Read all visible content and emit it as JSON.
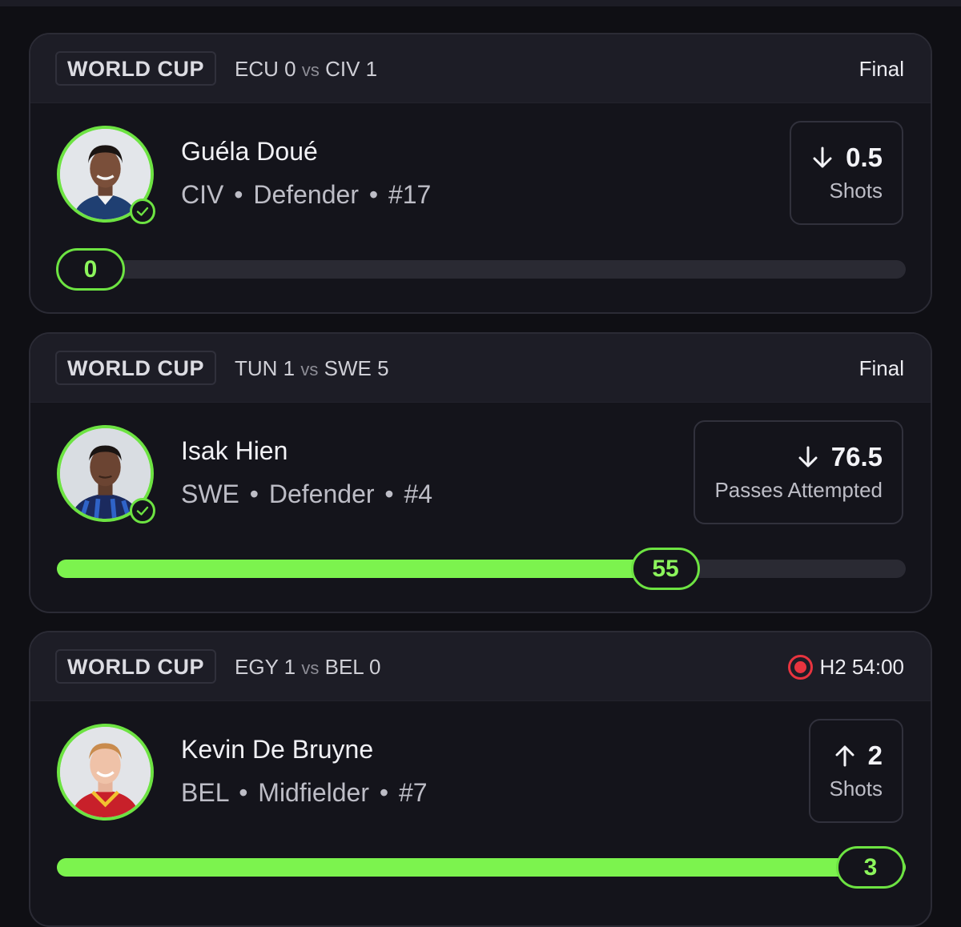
{
  "cards": [
    {
      "league": "WORLD CUP",
      "match": {
        "team1": "ECU",
        "score1": "0",
        "vs": "vs",
        "team2": "CIV",
        "score2": "1"
      },
      "status": "Final",
      "live": false,
      "player": {
        "name": "Guéla Doué",
        "team": "CIV",
        "position": "Defender",
        "number": "#17",
        "avatar": "player-photo",
        "verified": true
      },
      "prop": {
        "direction": "under",
        "direction_icon": "arrow-down-icon",
        "line": "0.5",
        "stat": "Shots"
      },
      "progress": {
        "value": "0",
        "fraction": 0.0
      }
    },
    {
      "league": "WORLD CUP",
      "match": {
        "team1": "TUN",
        "score1": "1",
        "vs": "vs",
        "team2": "SWE",
        "score2": "5"
      },
      "status": "Final",
      "live": false,
      "player": {
        "name": "Isak Hien",
        "team": "SWE",
        "position": "Defender",
        "number": "#4",
        "avatar": "player-photo",
        "verified": true
      },
      "prop": {
        "direction": "under",
        "direction_icon": "arrow-down-icon",
        "line": "76.5",
        "stat": "Passes Attempted"
      },
      "progress": {
        "value": "55",
        "fraction": 0.719
      }
    },
    {
      "league": "WORLD CUP",
      "match": {
        "team1": "EGY",
        "score1": "1",
        "vs": "vs",
        "team2": "BEL",
        "score2": "0"
      },
      "status": "H2 54:00",
      "live": true,
      "player": {
        "name": "Kevin De Bruyne",
        "team": "BEL",
        "position": "Midfielder",
        "number": "#7",
        "avatar": "player-photo",
        "verified": false
      },
      "prop": {
        "direction": "over",
        "direction_icon": "arrow-up-icon",
        "line": "2",
        "stat": "Shots"
      },
      "progress": {
        "value": "3",
        "fraction": 1.0
      }
    }
  ],
  "colors": {
    "accent": "#7cf34e",
    "live": "#e8343f",
    "background": "#0f0f14",
    "card": "#14141b",
    "header": "#1d1d26"
  },
  "separator": "•"
}
